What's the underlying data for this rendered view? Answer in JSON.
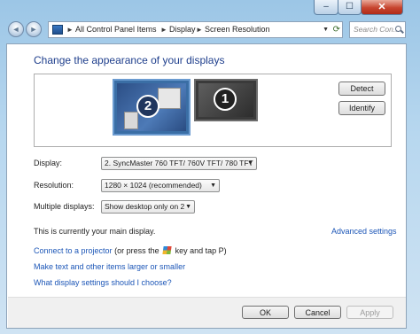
{
  "titlebar": {
    "minimize_label": "–",
    "maximize_label": "☐",
    "close_label": "✕"
  },
  "nav": {
    "back_icon": "◄",
    "forward_icon": "►",
    "breadcrumb": [
      "All Control Panel Items",
      "Display",
      "Screen Resolution"
    ],
    "separator": "►",
    "dropdown_icon": "▼",
    "refresh_icon": "⟳",
    "search_placeholder": "Search Con..."
  },
  "main": {
    "heading": "Change the appearance of your displays",
    "monitors": [
      {
        "number": "2",
        "selected": true
      },
      {
        "number": "1",
        "selected": false
      }
    ],
    "detect_label": "Detect",
    "identify_label": "Identify",
    "display_label": "Display:",
    "display_value": "2. SyncMaster 760 TFT/ 760V TFT/ 780 TFT",
    "resolution_label": "Resolution:",
    "resolution_value": "1280 × 1024 (recommended)",
    "multiple_label": "Multiple displays:",
    "multiple_value": "Show desktop only on 2",
    "select_arrow": "▼",
    "main_display_text": "This is currently your main display.",
    "advanced_link": "Advanced settings",
    "projector_link": "Connect to a projector",
    "projector_text_a": "(or press the",
    "projector_text_b": "key and tap P)",
    "text_size_link": "Make text and other items larger or smaller",
    "what_settings_link": "What display settings should I choose?"
  },
  "footer": {
    "ok_label": "OK",
    "cancel_label": "Cancel",
    "apply_label": "Apply"
  }
}
